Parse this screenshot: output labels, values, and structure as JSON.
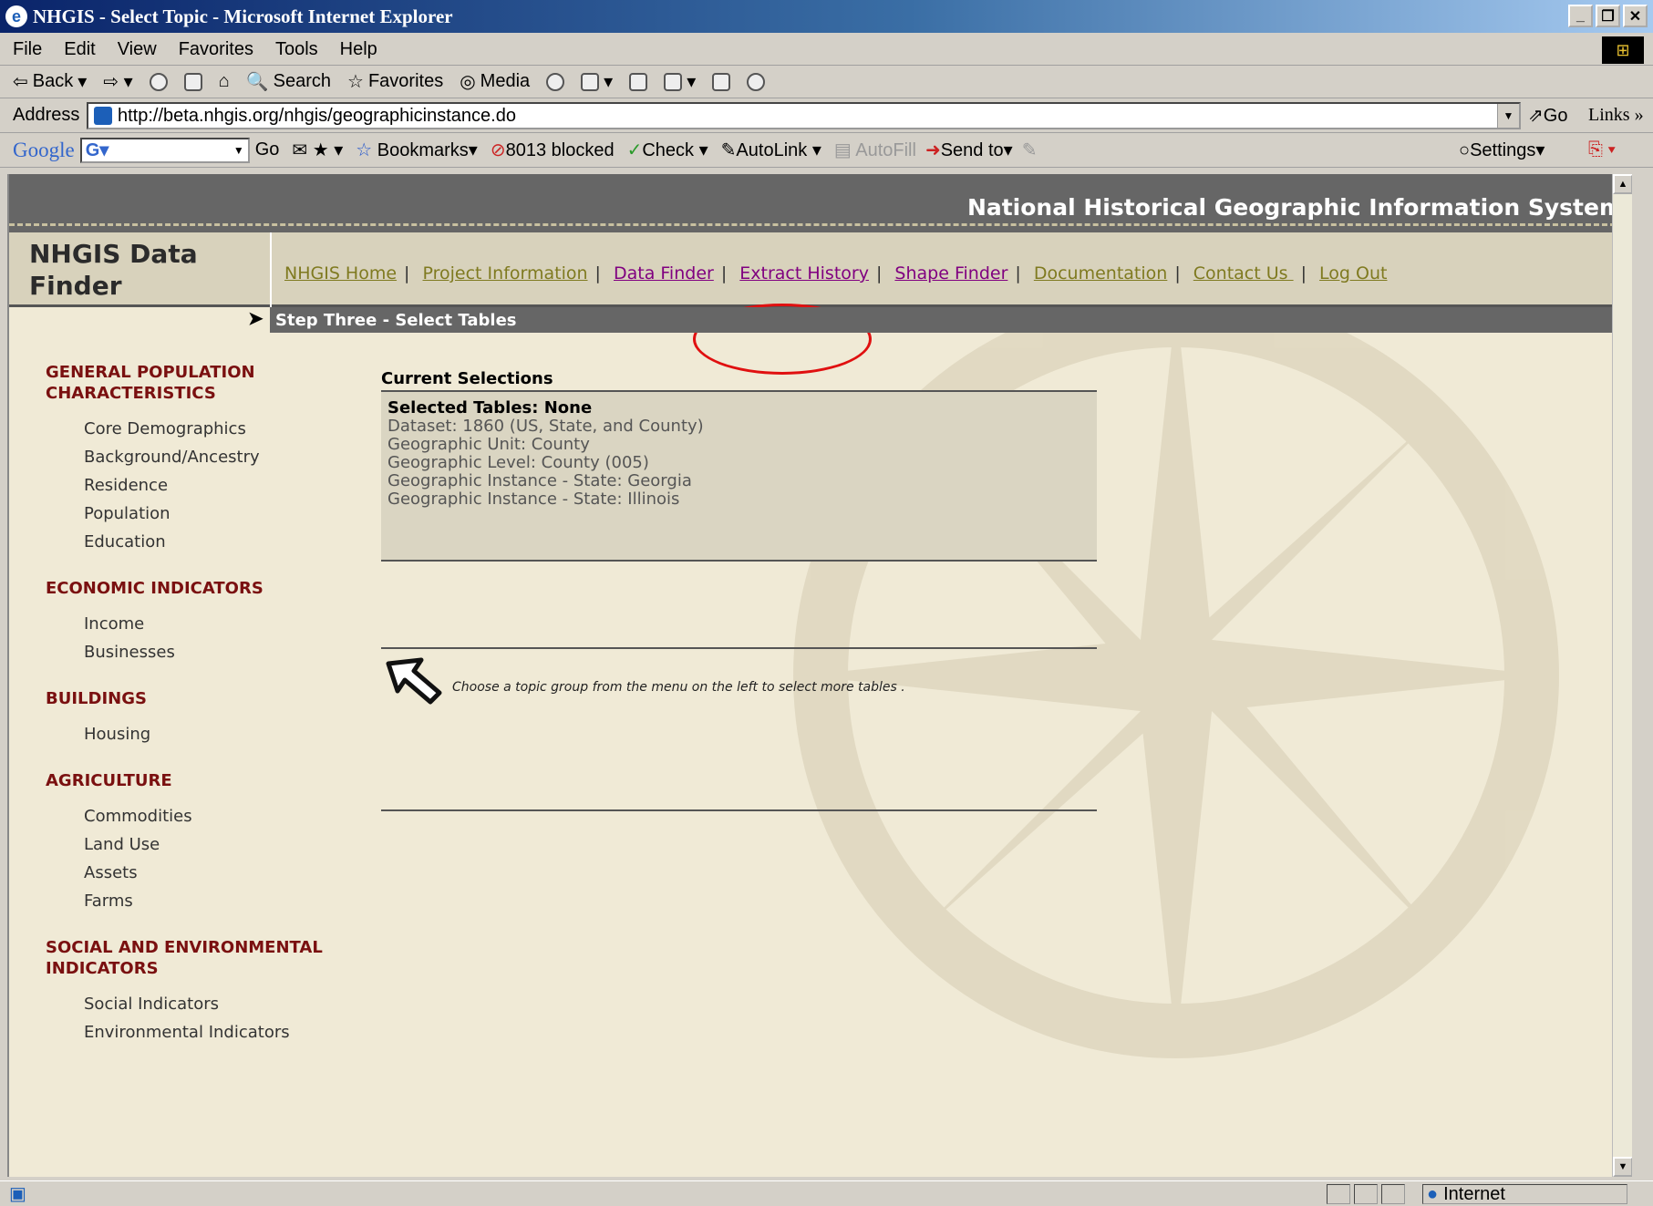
{
  "window": {
    "title": "NHGIS - Select Topic - Microsoft Internet Explorer"
  },
  "menu": [
    "File",
    "Edit",
    "View",
    "Favorites",
    "Tools",
    "Help"
  ],
  "toolbar": {
    "back": "Back",
    "search": "Search",
    "favorites": "Favorites",
    "media": "Media"
  },
  "address": {
    "label": "Address",
    "url": "http://beta.nhgis.org/nhgis/geographicinstance.do",
    "go": "Go",
    "links": "Links"
  },
  "google_bar": {
    "logo": "Google",
    "go": "Go",
    "bookmarks": "Bookmarks",
    "blocked": "8013 blocked",
    "check": "Check",
    "autolink": "AutoLink",
    "autofill": "AutoFill",
    "sendto": "Send to",
    "settings": "Settings"
  },
  "site": {
    "header_title": "National Historical Geographic Information System",
    "logo": "NHGIS Data Finder",
    "nav": [
      "NHGIS Home",
      "Project Information",
      "Data Finder",
      "Extract History",
      "Shape Finder",
      "Documentation",
      "Contact Us ",
      "Log Out"
    ],
    "step": "Step Three - Select Tables"
  },
  "sidebar": [
    {
      "label": "GENERAL POPULATION CHARACTERISTICS",
      "items": [
        "Core Demographics",
        "Background/Ancestry",
        "Residence",
        "Population",
        "Education"
      ]
    },
    {
      "label": "ECONOMIC INDICATORS",
      "items": [
        "Income",
        "Businesses"
      ]
    },
    {
      "label": "BUILDINGS",
      "items": [
        "Housing"
      ]
    },
    {
      "label": "AGRICULTURE",
      "items": [
        "Commodities",
        "Land Use",
        "Assets",
        "Farms"
      ]
    },
    {
      "label": "SOCIAL AND ENVIRONMENTAL INDICATORS",
      "items": [
        "Social Indicators",
        "Environmental Indicators"
      ]
    }
  ],
  "selections": {
    "title": "Current Selections",
    "tables": "Selected Tables: None",
    "lines": [
      "Dataset: 1860 (US, State, and County)",
      "Geographic Unit: County",
      "Geographic Level: County (005)",
      "Geographic Instance - State: Georgia",
      "Geographic Instance - State: Illinois"
    ]
  },
  "hint": "Choose a topic group from the menu on the left to select more tables .",
  "status": {
    "zone": "Internet"
  },
  "colors": {
    "header": "#666666",
    "nav_bg": "#d8d2bc",
    "category": "#7a1010",
    "highlight": "#e01010"
  }
}
